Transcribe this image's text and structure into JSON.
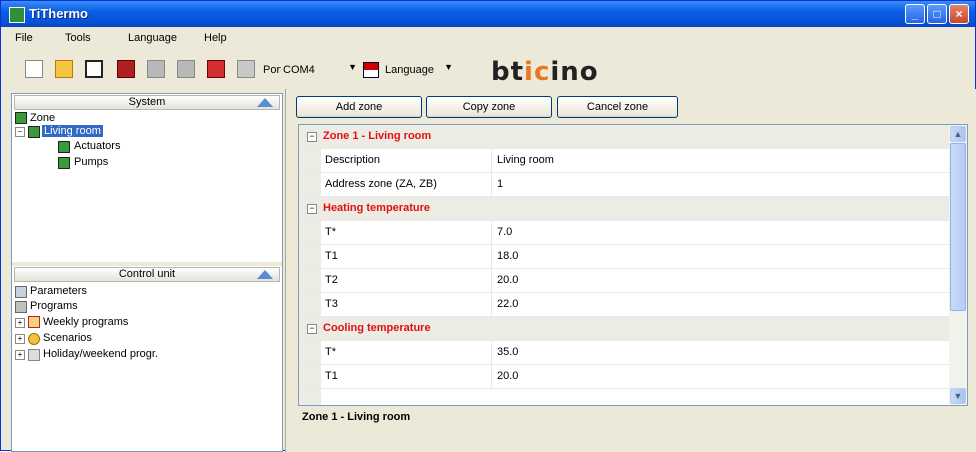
{
  "window": {
    "title": "TiThermo"
  },
  "menu": [
    "File",
    "Tools",
    "Language",
    "Help"
  ],
  "toolbar": {
    "port_label": "Port",
    "port_value": "COM4",
    "language_value": "Language",
    "brand": "bticino"
  },
  "system_panel": {
    "header": "System",
    "items": [
      {
        "label": "Zone",
        "icon": "zone-icon"
      },
      {
        "label": "Living room",
        "icon": "zone-icon",
        "selected": true
      },
      {
        "label": "Actuators",
        "icon": "actuator-icon"
      },
      {
        "label": "Pumps",
        "icon": "pump-icon"
      }
    ]
  },
  "control_panel": {
    "header": "Control unit",
    "items": [
      {
        "label": "Parameters",
        "icon": "parameters-icon"
      },
      {
        "label": "Programs",
        "icon": "programs-icon"
      },
      {
        "label": "Weekly programs",
        "icon": "calendar-icon"
      },
      {
        "label": "Scenarios",
        "icon": "scenario-icon"
      },
      {
        "label": "Holiday/weekend progr.",
        "icon": "holiday-icon"
      }
    ]
  },
  "actions": {
    "add": "Add zone",
    "copy": "Copy zone",
    "cancel": "Cancel zone"
  },
  "grid": {
    "zone_header": "Zone 1 - Living room",
    "description_label": "Description",
    "description_value": "Living room",
    "address_label": "Address zone (ZA, ZB)",
    "address_value": "1",
    "heating_header": "Heating temperature",
    "heating": [
      {
        "name": "T*",
        "value": "7.0"
      },
      {
        "name": "T1",
        "value": "18.0"
      },
      {
        "name": "T2",
        "value": "20.0"
      },
      {
        "name": "T3",
        "value": "22.0"
      }
    ],
    "cooling_header": "Cooling temperature",
    "cooling": [
      {
        "name": "T*",
        "value": "35.0"
      },
      {
        "name": "T1",
        "value": "20.0"
      }
    ]
  },
  "description_box": {
    "title": "Zone 1 - Living room"
  },
  "colors": {
    "category_title": "#e01010",
    "selection": "#316ac5",
    "titlebar": "#0a5fe8"
  }
}
